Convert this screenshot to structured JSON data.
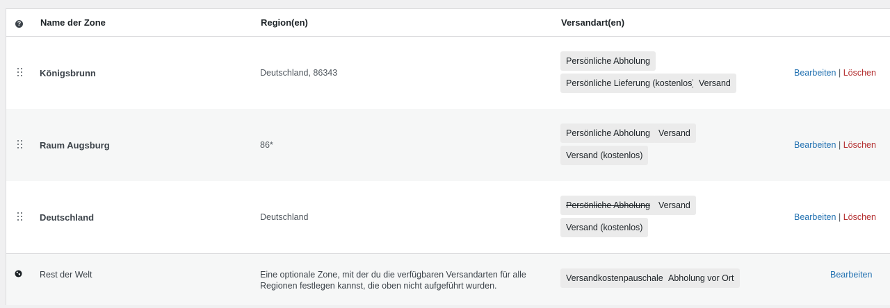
{
  "header": {
    "name_label": "Name der Zone",
    "region_label": "Region(en)",
    "methods_label": "Versandart(en)",
    "help_glyph": "?"
  },
  "zones": [
    {
      "name": "Königsbrunn",
      "region": "Deutschland, 86343",
      "methods": [
        "Persönliche Abholung",
        "Persönliche Lieferung (kostenlos)",
        "Versand"
      ],
      "edit_label": "Bearbeiten",
      "separator": "|",
      "delete_label": "Löschen"
    },
    {
      "name": "Raum Augsburg",
      "region": "86*",
      "methods": [
        "Persönliche Abholung",
        "Versand",
        "Versand (kostenlos)"
      ],
      "edit_label": "Bearbeiten",
      "separator": "|",
      "delete_label": "Löschen"
    },
    {
      "name": "Deutschland",
      "region": "Deutschland",
      "methods": [
        "Persönliche Abholung",
        "Versand",
        "Versand (kostenlos)"
      ],
      "disabled_methods": [
        "Persönliche Abholung"
      ],
      "edit_label": "Bearbeiten",
      "separator": "|",
      "delete_label": "Löschen"
    }
  ],
  "rest_of_world": {
    "name": "Rest der Welt",
    "description_line1": "Eine optionale Zone, mit der du die verfügbaren Versandarten für alle",
    "description_line2": "Regionen festlegen kannst, die oben nicht aufgeführt wurden.",
    "methods": [
      "Versandkostenpauschale",
      "Abholung vor Ort"
    ],
    "edit_label": "Bearbeiten"
  },
  "colors": {
    "link": "#2271b1",
    "delete": "#b32d2e",
    "pill_bg": "#ebebeb"
  }
}
